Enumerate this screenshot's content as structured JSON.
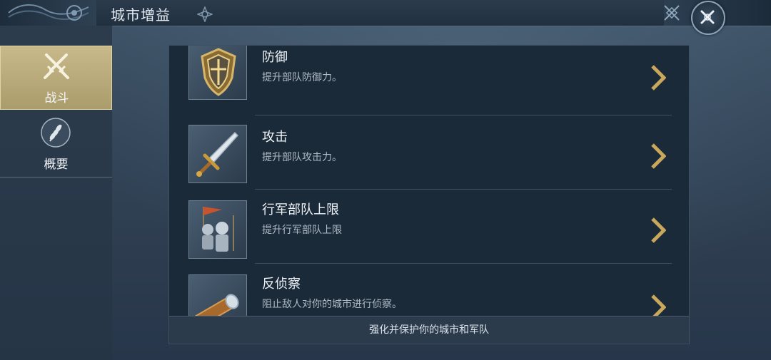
{
  "header": {
    "title": "城市增益",
    "close_icon": "close-x-icon"
  },
  "sidebar": {
    "items": [
      {
        "label": "战斗",
        "icon": "crossed-swords-icon",
        "active": true
      },
      {
        "label": "概要",
        "icon": "wheat-icon",
        "active": false
      }
    ]
  },
  "buffs": [
    {
      "title": "防御",
      "desc": "提升部队防御力。",
      "icon": "shield-icon"
    },
    {
      "title": "攻击",
      "desc": "提升部队攻击力。",
      "icon": "sword-icon"
    },
    {
      "title": "行军部队上限",
      "desc": "提升行军部队上限",
      "icon": "knights-icon"
    },
    {
      "title": "反侦察",
      "desc": "阻止敌人对你的城市进行侦察。",
      "icon": "spyglass-icon"
    }
  ],
  "footer": {
    "text": "强化并保护你的城市和军队"
  },
  "colors": {
    "accent_gold": "#c8b98a",
    "chevron_gold": "#c9a85c",
    "panel_bg": "#1b2a39"
  }
}
